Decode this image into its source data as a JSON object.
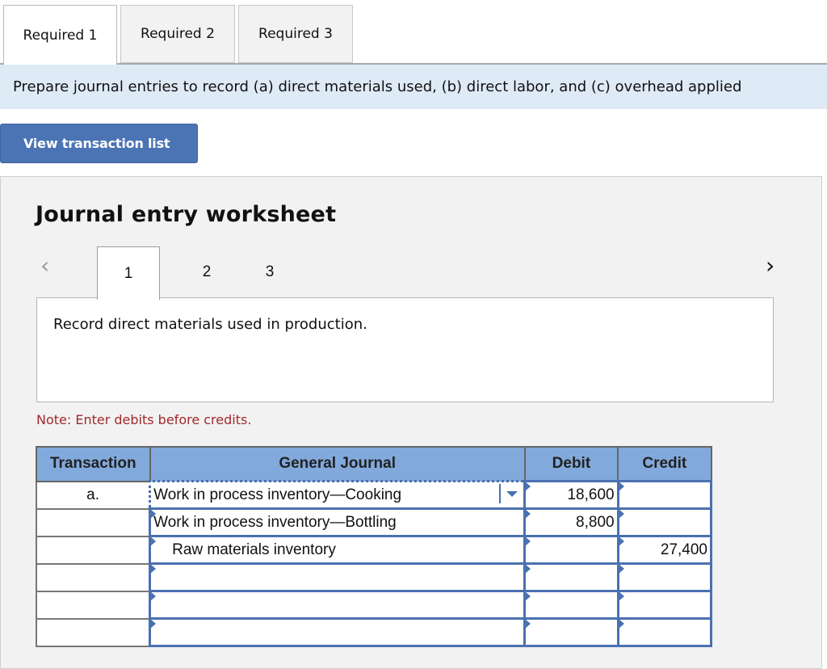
{
  "required_tabs": [
    {
      "label": "Required 1",
      "active": true
    },
    {
      "label": "Required 2",
      "active": false
    },
    {
      "label": "Required 3",
      "active": false
    }
  ],
  "instruction": "Prepare journal entries to record (a) direct materials used, (b) direct labor, and (c) overhead applied",
  "view_transaction_button": "View transaction list",
  "worksheet": {
    "title": "Journal entry worksheet",
    "nav_prev_icon": "<",
    "nav_next_icon": ">",
    "steps": [
      "1",
      "2",
      "3"
    ],
    "active_step": "1",
    "description": "Record direct materials used in production.",
    "note": "Note: Enter debits before credits."
  },
  "journal": {
    "headers": {
      "transaction": "Transaction",
      "account": "General Journal",
      "debit": "Debit",
      "credit": "Credit"
    },
    "rows": [
      {
        "transaction": "a.",
        "account": "Work in process inventory—Cooking",
        "debit": "18,600",
        "credit": ""
      },
      {
        "transaction": "",
        "account": "Work in process inventory—Bottling",
        "debit": "8,800",
        "credit": ""
      },
      {
        "transaction": "",
        "account": "Raw materials inventory",
        "debit": "",
        "credit": "27,400"
      },
      {
        "transaction": "",
        "account": "",
        "debit": "",
        "credit": ""
      },
      {
        "transaction": "",
        "account": "",
        "debit": "",
        "credit": ""
      },
      {
        "transaction": "",
        "account": "",
        "debit": "",
        "credit": ""
      }
    ]
  },
  "colors": {
    "header_blue": "#82a9dc",
    "button_blue": "#4b74b4",
    "instruction_bg": "#dfeaf7",
    "note_red": "#a3282a",
    "input_border": "#4a71b0"
  }
}
